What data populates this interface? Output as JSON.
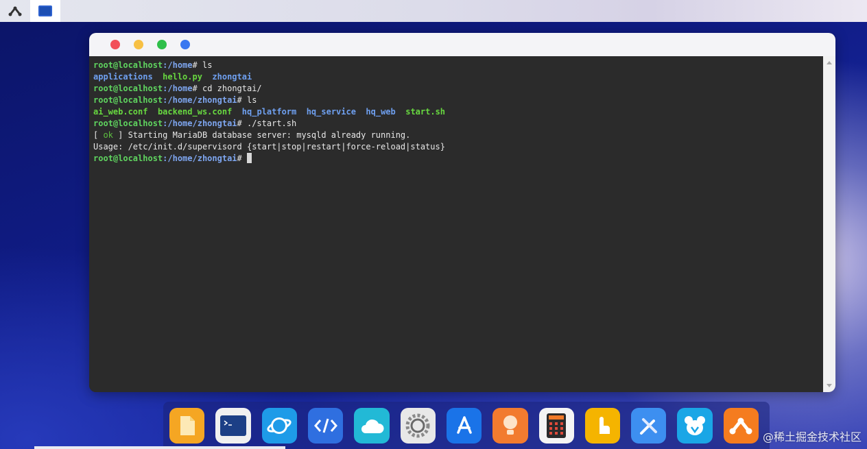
{
  "topbar": {
    "icons": [
      "app-launcher-icon",
      "terminal-window-icon"
    ]
  },
  "window": {
    "traffic_lights": [
      "red",
      "yellow",
      "green",
      "blue"
    ]
  },
  "terminal": {
    "prompt_user": "root@localhost",
    "lines": {
      "l1": {
        "path": ":/home",
        "cmd": "# ls"
      },
      "l2": {
        "items": [
          "applications",
          "hello.py",
          "zhongtai"
        ]
      },
      "l3": {
        "path": ":/home",
        "cmd": "# cd zhongtai/"
      },
      "l4": {
        "path": ":/home/zhongtai",
        "cmd": "# ls"
      },
      "l5": {
        "items": [
          "ai_web.conf",
          "backend_ws.conf",
          "hq_platform",
          "hq_service",
          "hq_web",
          "start.sh"
        ]
      },
      "l6": {
        "path": ":/home/zhongtai",
        "cmd": "# ./start.sh"
      },
      "l7": {
        "open": "[ ",
        "ok": "ok",
        "text": " ] Starting MariaDB database server: mysqld already running."
      },
      "l8": {
        "text": "Usage: /etc/init.d/supervisord {start|stop|restart|force-reload|status}"
      },
      "l9": {
        "path": ":/home/zhongtai",
        "cmd": "# "
      }
    }
  },
  "dock": {
    "apps": [
      {
        "icon": "files-icon",
        "color": "#f5a623"
      },
      {
        "icon": "terminal-icon",
        "color": "#f0f0f0"
      },
      {
        "icon": "browser-icon",
        "color": "#1e9be8"
      },
      {
        "icon": "code-editor-icon",
        "color": "#2f6fe0"
      },
      {
        "icon": "cloud-icon",
        "color": "#22b9d6"
      },
      {
        "icon": "settings-icon",
        "color": "#e8e8e8"
      },
      {
        "icon": "app-store-icon",
        "color": "#1a73e8"
      },
      {
        "icon": "tips-icon",
        "color": "#f27b2f"
      },
      {
        "icon": "calculator-icon",
        "color": "#f4f4f4"
      },
      {
        "icon": "touch-icon",
        "color": "#f5b400"
      },
      {
        "icon": "tools-icon",
        "color": "#3d8ff0"
      },
      {
        "icon": "bear-icon",
        "color": "#1aa6e6"
      },
      {
        "icon": "app-launcher-icon",
        "color": "#f57c1f"
      }
    ]
  },
  "watermark": "@稀土掘金技术社区"
}
